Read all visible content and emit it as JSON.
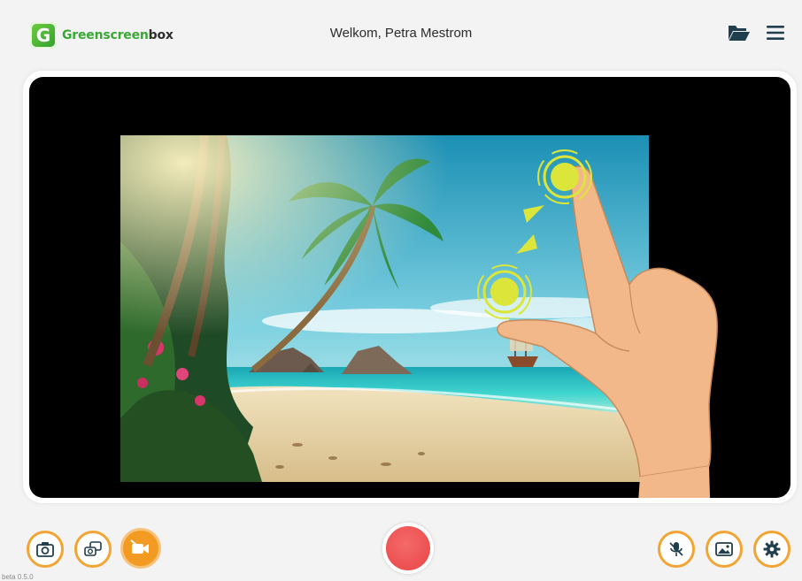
{
  "header": {
    "brand_part1": "Greenscreen",
    "brand_part2": "box",
    "logo_letter": "G",
    "welcome": "Welkom, Petra Mestrom",
    "icons": [
      "folder-open-icon",
      "hamburger-menu-icon"
    ]
  },
  "toolbar": {
    "left": [
      {
        "name": "photo-camera-button",
        "icon": "camera-icon",
        "active": false
      },
      {
        "name": "switch-camera-button",
        "icon": "camera-switch-icon",
        "active": false
      },
      {
        "name": "video-off-button",
        "icon": "video-off-icon",
        "active": true
      }
    ],
    "center": {
      "name": "record-button",
      "icon": "record-icon"
    },
    "right": [
      {
        "name": "microphone-mute-button",
        "icon": "microphone-off-icon",
        "active": false
      },
      {
        "name": "background-image-button",
        "icon": "image-icon",
        "active": false
      },
      {
        "name": "settings-button",
        "icon": "gear-icon",
        "active": false
      }
    ]
  },
  "colors": {
    "accent": "#f2a534",
    "brand_green": "#3aa835",
    "record_red": "#e94444",
    "gesture_yellow": "#dce63a"
  },
  "version": "beta 0.5.0"
}
